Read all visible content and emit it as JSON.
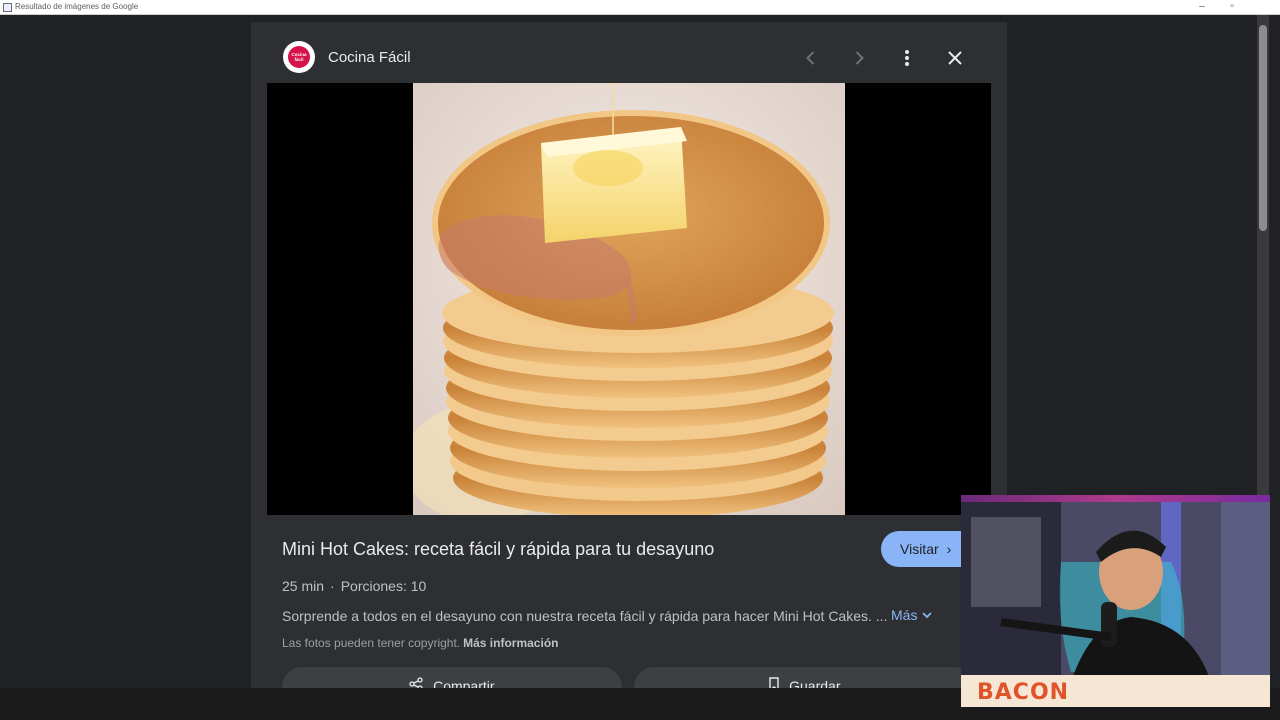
{
  "window": {
    "title": "Resultado de imágenes de Google",
    "minimize_icon": "minimize-icon",
    "restore_icon": "restore-icon"
  },
  "viewer": {
    "source_name": "Cocina Fácil",
    "logo_text": "Cocina Fácil",
    "prev_icon": "chevron-left-icon",
    "next_icon": "chevron-right-icon",
    "more_icon": "more-vert-icon",
    "close_icon": "close-icon",
    "result_title": "Mini Hot Cakes: receta fácil y rápida para tu desayuno",
    "visit_label": "Visitar",
    "meta": {
      "time": "25 min",
      "separator": "·",
      "servings": "Porciones: 10"
    },
    "description": "Sorprende a todos en el desayuno con nuestra receta fácil y rápida para hacer Mini Hot Cakes. ...",
    "more_label": "Más",
    "copyright_text": "Las fotos pueden tener copyright.",
    "copyright_link": "Más información",
    "share_label": "Compartir",
    "save_label": "Guardar"
  },
  "webcam": {
    "caption": "BACON"
  },
  "colors": {
    "accent": "#8ab4f8",
    "panel_bg": "#2e2f32",
    "page_bg": "#202124",
    "logo_red": "#d6124a"
  }
}
